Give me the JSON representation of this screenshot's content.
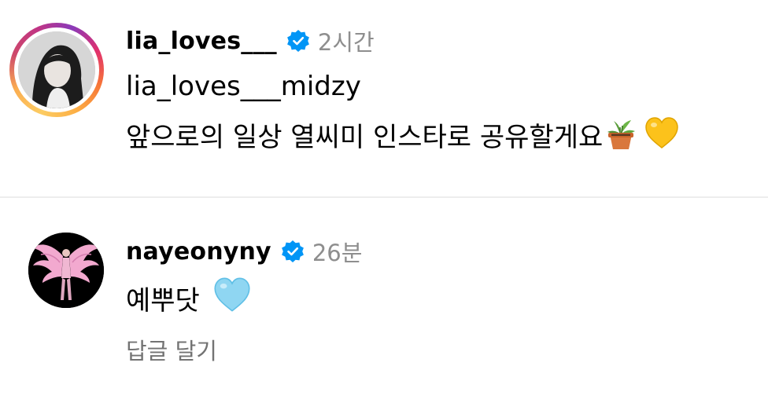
{
  "caption": {
    "username": "lia_loves___",
    "time": "2시간",
    "line1": "lia_loves___midzy",
    "line2": "앞으로의 일상 열씨미 인스타로 공유할게요",
    "emojis": [
      "potted-plant",
      "yellow-heart"
    ]
  },
  "comment": {
    "username": "nayeonyny",
    "time": "26분",
    "text": "예뿌닷",
    "emoji": "light-blue-heart",
    "reply_label": "답글 달기"
  },
  "colors": {
    "verified_badge": "#0095f6",
    "secondary_text": "#8e8e8e",
    "reply_text": "#737373",
    "divider": "#ededed"
  }
}
